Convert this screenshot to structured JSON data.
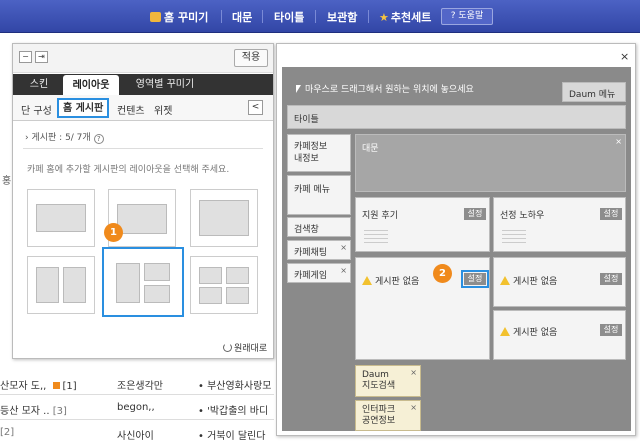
{
  "topnav": {
    "items": [
      "홈 꾸미기",
      "대문",
      "타이틀",
      "보관함",
      "추천세트"
    ],
    "help": "? 도움말"
  },
  "background": {
    "rows": [
      {
        "left": "산모자 도,,",
        "mark": "[1]",
        "mid": "조은생각만",
        "right": "부산영화사랑모"
      },
      {
        "left": "등산 모자 ..",
        "mark": "[3]",
        "mid": "begon,,",
        "right": "'박갑출의 바디"
      },
      {
        "left": "",
        "mark": "[2]",
        "mid": "사신아이",
        "right": "거북이 달린다"
      }
    ],
    "side_char": "홍"
  },
  "left_panel": {
    "apply": "적용",
    "minimize": "−",
    "pin": "⇥",
    "tabs": [
      "스킨",
      "레이아웃",
      "영역별 꾸미기"
    ],
    "subtabs": [
      "단 구성",
      "홈 게시판",
      "컨텐츠",
      "위젯"
    ],
    "board_count": "게시판 : 5/ 7개",
    "instruction": "카페 홈에 추가할 게시판의 레이아웃을 선택해 주세요.",
    "badge": "1",
    "restore": "원래대로",
    "nav_arrow": "<"
  },
  "right_panel": {
    "close": "×",
    "drag_hint": "마우스로 드래그해서 원하는 위치에 놓으세요",
    "daum_menu": "Daum 메뉴",
    "title_block": "타이틀",
    "cafe_info": "카페정보\n내정보",
    "cafe_menu": "카페 메뉴",
    "search": "검색창",
    "chat": "카페채팅",
    "game": "카페게임",
    "front": "대문",
    "widget1": "지원 후기",
    "widget2": "선정 노하우",
    "board_empty": "게시판 없음",
    "setting": "설정",
    "badge": "2",
    "daum_search": "Daum\n지도검색",
    "interpark": "인터파크\n공연정보",
    "cross": "×"
  }
}
